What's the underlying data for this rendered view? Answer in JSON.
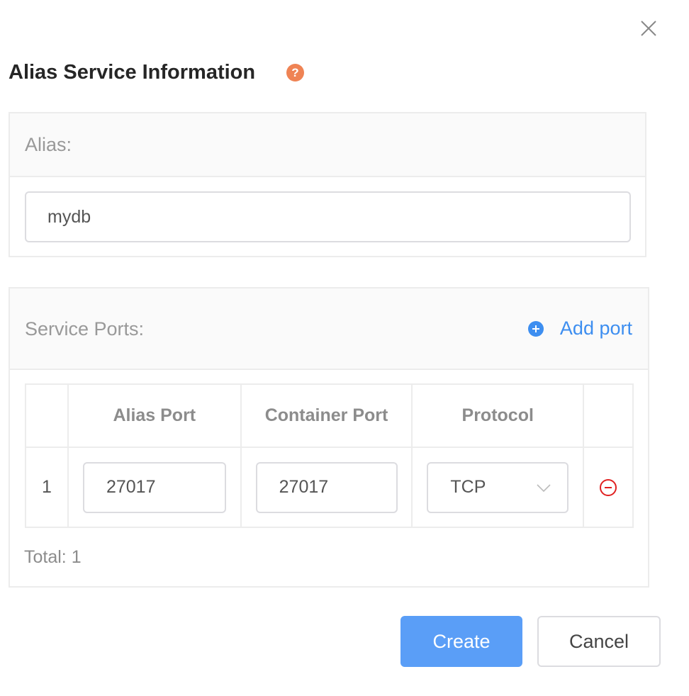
{
  "dialog": {
    "title": "Alias Service Information",
    "help_icon": "?",
    "close_icon": "close-icon"
  },
  "alias": {
    "label": "Alias:",
    "value": "mydb"
  },
  "ports": {
    "label": "Service Ports:",
    "add_label": "Add port",
    "columns": [
      "",
      "Alias Port",
      "Container Port",
      "Protocol",
      ""
    ],
    "rows": [
      {
        "index": "1",
        "alias_port": "27017",
        "container_port": "27017",
        "protocol": "TCP"
      }
    ],
    "total": "Total: 1"
  },
  "actions": {
    "create": "Create",
    "cancel": "Cancel"
  },
  "colors": {
    "accent": "#5a9ef7",
    "link": "#3d8ef0",
    "help": "#ef8354",
    "danger": "#e02020"
  }
}
